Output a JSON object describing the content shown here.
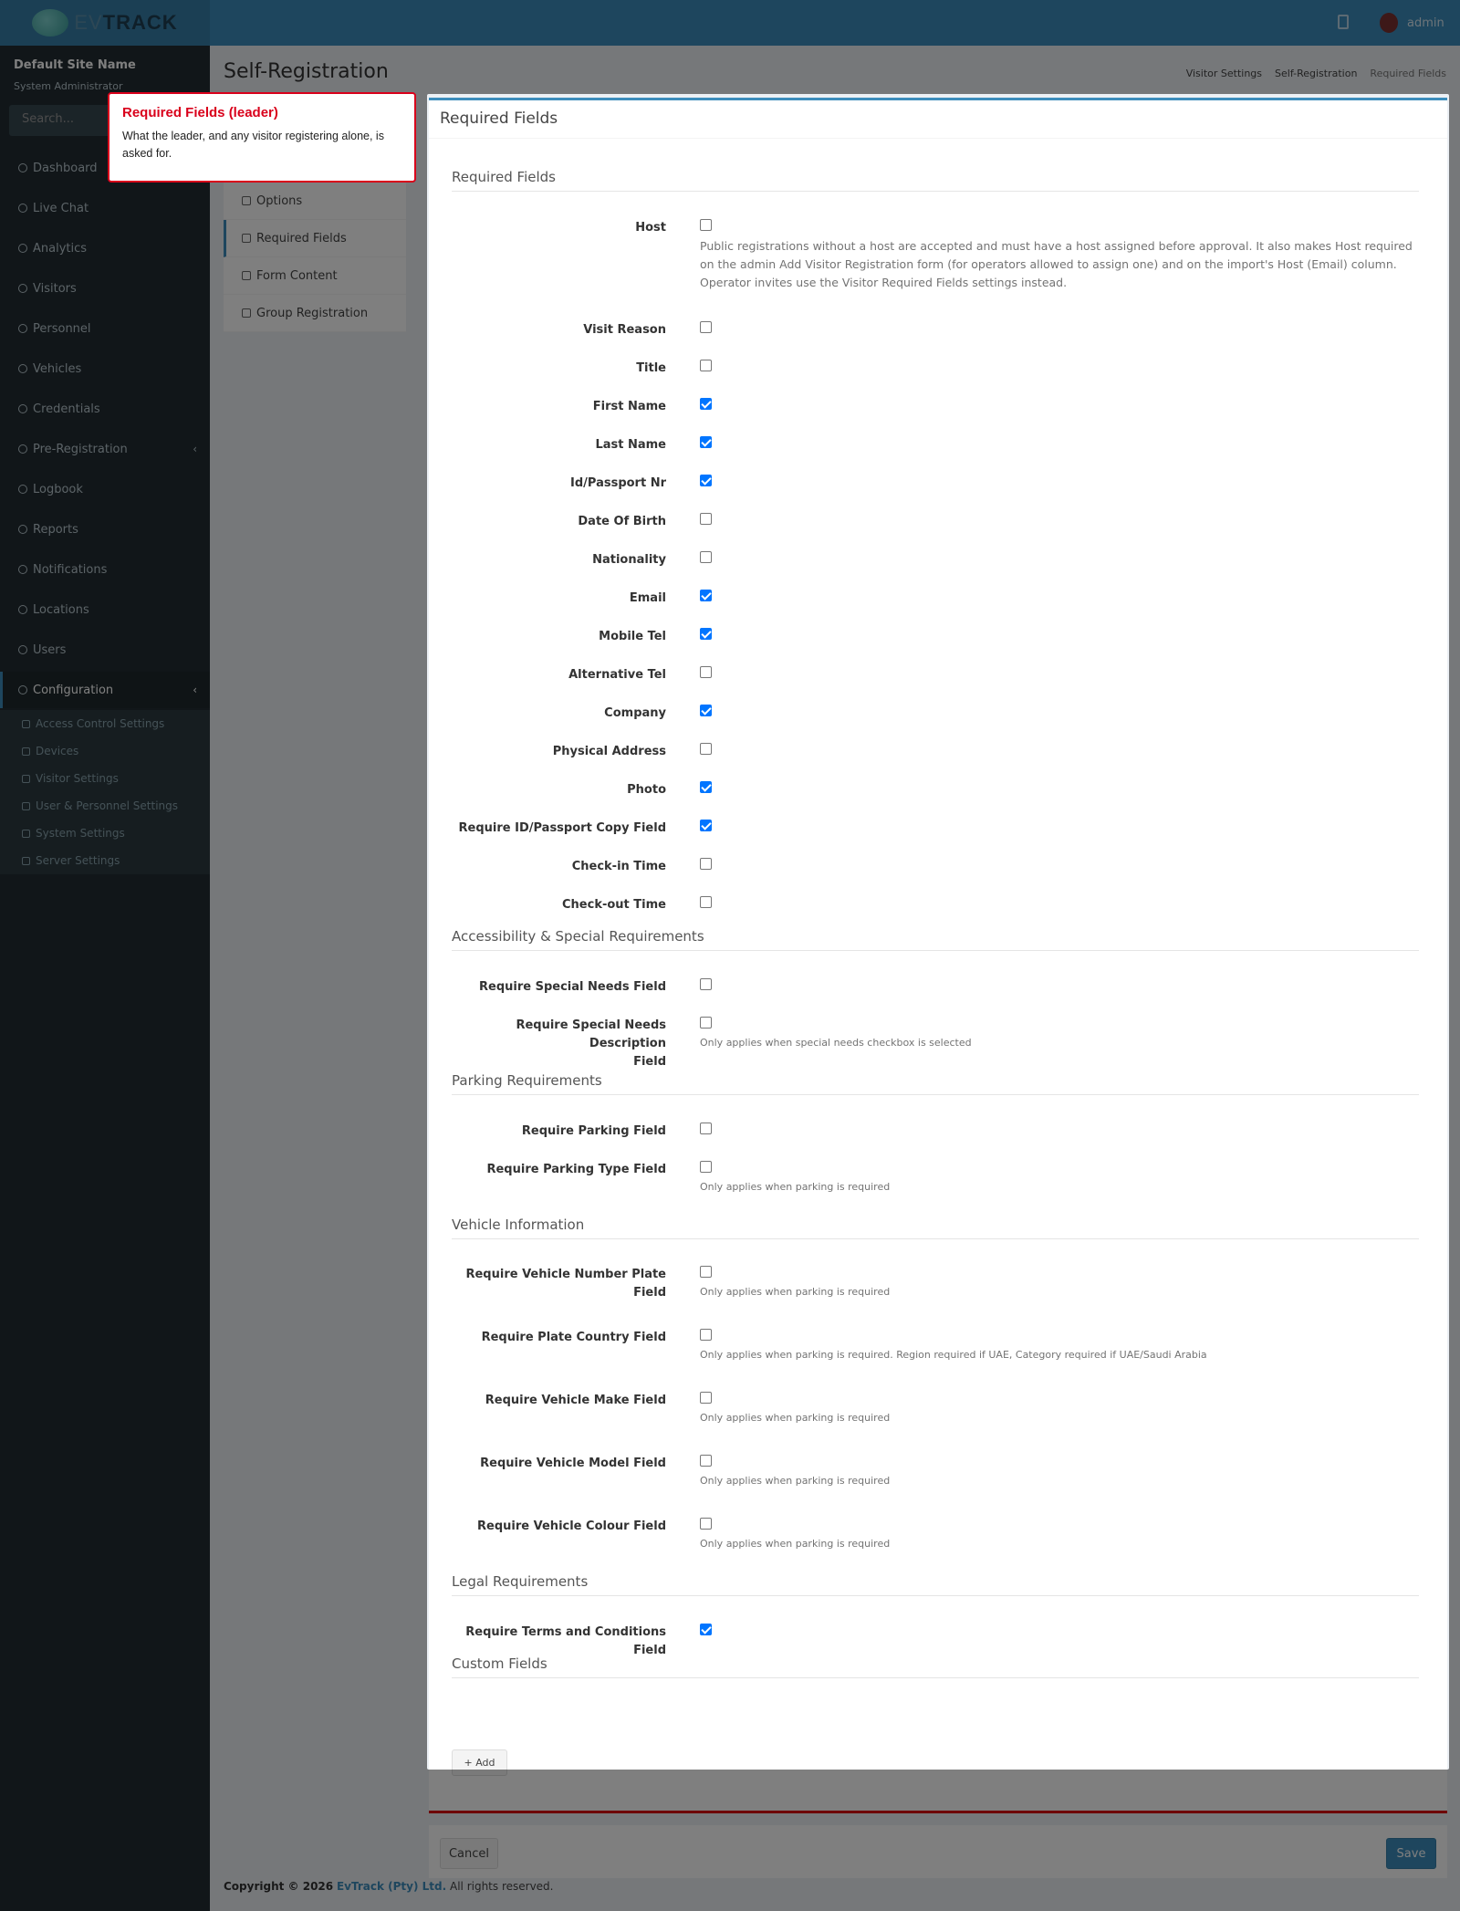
{
  "header": {
    "brand_ev": "EV",
    "brand_track": "TRACK",
    "user": "admin"
  },
  "sidebar": {
    "site_name": "Default Site Name",
    "role": "System Administrator",
    "search_placeholder": "Search...",
    "items": [
      {
        "label": "Dashboard"
      },
      {
        "label": "Live Chat"
      },
      {
        "label": "Analytics"
      },
      {
        "label": "Visitors"
      },
      {
        "label": "Personnel"
      },
      {
        "label": "Vehicles"
      },
      {
        "label": "Credentials"
      },
      {
        "label": "Pre-Registration"
      },
      {
        "label": "Logbook"
      },
      {
        "label": "Reports"
      },
      {
        "label": "Notifications"
      },
      {
        "label": "Locations"
      },
      {
        "label": "Users"
      },
      {
        "label": "Configuration"
      }
    ],
    "sub_items": [
      {
        "label": "Access Control Settings"
      },
      {
        "label": "Devices"
      },
      {
        "label": "Visitor Settings"
      },
      {
        "label": "User & Personnel Settings"
      },
      {
        "label": "System Settings"
      },
      {
        "label": "Server Settings"
      }
    ]
  },
  "page": {
    "title": "Self-Registration",
    "breadcrumb": [
      "Visitor Settings",
      "Self-Registration",
      "Required Fields"
    ]
  },
  "subnav": [
    {
      "label": "Options"
    },
    {
      "label": "Required Fields"
    },
    {
      "label": "Form Content"
    },
    {
      "label": "Group Registration"
    }
  ],
  "box": {
    "title": "Required Fields"
  },
  "sections": {
    "required": "Required Fields",
    "accessibility": "Accessibility & Special Requirements",
    "parking": "Parking Requirements",
    "vehicle": "Vehicle Information",
    "legal": "Legal Requirements",
    "custom": "Custom Fields"
  },
  "fields": {
    "host": {
      "label": "Host",
      "checked": false,
      "help": "Public registrations without a host are accepted and must have a host assigned before approval. It also makes Host required on the admin Add Visitor Registration form (for operators allowed to assign one) and on the import's Host (Email) column. Operator invites use the Visitor Required Fields settings instead."
    },
    "visit_reason": {
      "label": "Visit Reason",
      "checked": false
    },
    "title": {
      "label": "Title",
      "checked": false
    },
    "first_name": {
      "label": "First Name",
      "checked": true
    },
    "last_name": {
      "label": "Last Name",
      "checked": true
    },
    "id_passport": {
      "label": "Id/Passport Nr",
      "checked": true
    },
    "dob": {
      "label": "Date Of Birth",
      "checked": false
    },
    "nationality": {
      "label": "Nationality",
      "checked": false
    },
    "email": {
      "label": "Email",
      "checked": true
    },
    "mobile": {
      "label": "Mobile Tel",
      "checked": true
    },
    "alt_tel": {
      "label": "Alternative Tel",
      "checked": false
    },
    "company": {
      "label": "Company",
      "checked": true
    },
    "address": {
      "label": "Physical Address",
      "checked": false
    },
    "photo": {
      "label": "Photo",
      "checked": true
    },
    "id_copy": {
      "label": "Require ID/Passport Copy Field",
      "checked": true
    },
    "checkin": {
      "label": "Check-in Time",
      "checked": false
    },
    "checkout": {
      "label": "Check-out Time",
      "checked": false
    },
    "special_needs": {
      "label": "Require Special Needs Field",
      "checked": false
    },
    "special_desc_1": "Require Special Needs Description",
    "special_desc_2": "Field",
    "special_desc_help": "Only applies when special needs checkbox is selected",
    "parking": {
      "label": "Require Parking Field",
      "checked": false
    },
    "parking_type": {
      "label": "Require Parking Type Field",
      "checked": false,
      "help": "Only applies when parking is required"
    },
    "plate": {
      "label": "Require Vehicle Number Plate Field",
      "checked": false,
      "help": "Only applies when parking is required"
    },
    "plate_country": {
      "label": "Require Plate Country Field",
      "checked": false,
      "help": "Only applies when parking is required. Region required if UAE, Category required if UAE/Saudi Arabia"
    },
    "make": {
      "label": "Require Vehicle Make Field",
      "checked": false,
      "help": "Only applies when parking is required"
    },
    "model": {
      "label": "Require Vehicle Model Field",
      "checked": false,
      "help": "Only applies when parking is required"
    },
    "colour": {
      "label": "Require Vehicle Colour Field",
      "checked": false,
      "help": "Only applies when parking is required"
    },
    "terms": {
      "label": "Require Terms and Conditions Field",
      "checked": true
    }
  },
  "buttons": {
    "add": "+ Add",
    "cancel": "Cancel",
    "save": "Save"
  },
  "footer": {
    "copyright": "Copyright © 2026",
    "company": "EvTrack (Pty) Ltd.",
    "rights": "All rights reserved."
  },
  "tooltip": {
    "title": "Required Fields (leader)",
    "body": "What the leader, and any visitor registering alone, is asked for."
  }
}
